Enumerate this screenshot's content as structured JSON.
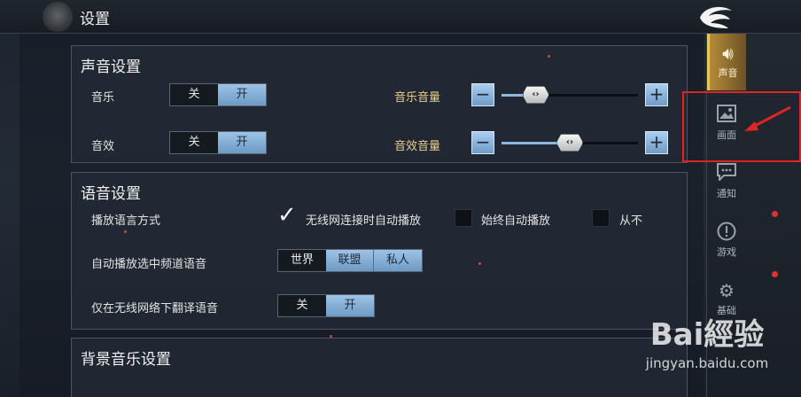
{
  "header": {
    "title": "设置"
  },
  "sections": {
    "sound": {
      "title": "声音设置",
      "music_label": "音乐",
      "music_options": [
        "关",
        "开"
      ],
      "music_active": 1,
      "music_volume_label": "音乐音量",
      "music_volume": 0.25,
      "effects_label": "音效",
      "effects_options": [
        "关",
        "开"
      ],
      "effects_active": 1,
      "effects_volume_label": "音效音量",
      "effects_volume": 0.5
    },
    "voice": {
      "title": "语音设置",
      "playback_label": "播放语言方式",
      "playback_options": [
        "无线网连接时自动播放",
        "始终自动播放",
        "从不"
      ],
      "playback_checked": 0,
      "channel_label": "自动播放选中频道语音",
      "channel_options": [
        "世界",
        "联盟",
        "私人"
      ],
      "channel_active": [
        false,
        true,
        true
      ],
      "translate_label": "仅在无线网络下翻译语音",
      "translate_options": [
        "关",
        "开"
      ],
      "translate_active": 1
    },
    "bgm": {
      "title": "背景音乐设置"
    }
  },
  "sidebar": {
    "items": [
      {
        "label": "声音",
        "icon": "speaker-icon",
        "active": true
      },
      {
        "label": "画面",
        "icon": "picture-icon",
        "active": false
      },
      {
        "label": "通知",
        "icon": "chat-icon",
        "active": false,
        "badge": true
      },
      {
        "label": "游戏",
        "icon": "alert-circle-icon",
        "active": false,
        "badge": true
      },
      {
        "label": "基础",
        "icon": "gear-icon",
        "active": false
      }
    ]
  },
  "watermark": {
    "logo": "Bai經验",
    "url": "jingyan.baidu.com"
  },
  "colors": {
    "accent": "#8eb8df",
    "gold": "#e8cf8e",
    "annotation": "#e02323"
  }
}
